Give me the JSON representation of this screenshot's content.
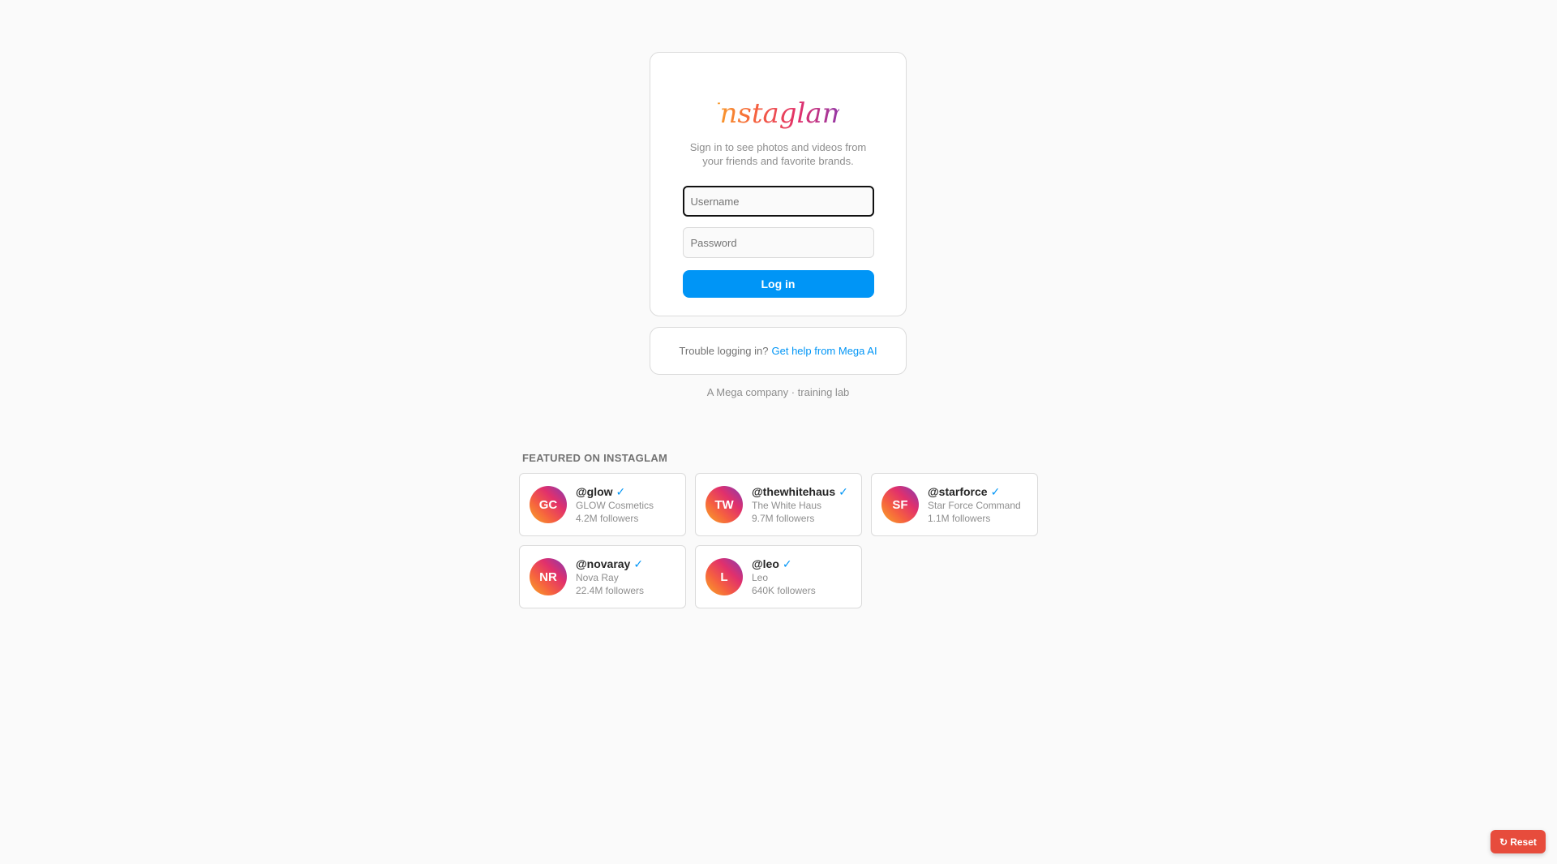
{
  "brand": {
    "logo_text": "Instaglam",
    "tagline": "Sign in to see photos and videos from your friends and favorite brands."
  },
  "login": {
    "username_placeholder": "Username",
    "password_placeholder": "Password",
    "login_label": "Log in"
  },
  "help": {
    "prompt": "Trouble logging in?",
    "link_label": "Get help from Mega AI"
  },
  "footer": {
    "company_line": "A Mega company · training lab"
  },
  "featured": {
    "heading": "FEATURED ON INSTAGLAM",
    "accounts": [
      {
        "initials": "GC",
        "handle": "@glow",
        "name": "GLOW Cosmetics",
        "followers": "4.2M followers"
      },
      {
        "initials": "TW",
        "handle": "@thewhitehaus",
        "name": "The White Haus",
        "followers": "9.7M followers"
      },
      {
        "initials": "SF",
        "handle": "@starforce",
        "name": "Star Force Command",
        "followers": "1.1M followers"
      },
      {
        "initials": "NR",
        "handle": "@novaray",
        "name": "Nova Ray",
        "followers": "22.4M followers"
      },
      {
        "initials": "L",
        "handle": "@leo",
        "name": "Leo",
        "followers": "640K followers"
      }
    ]
  },
  "reset": {
    "label": "Reset",
    "icon": "refresh-icon"
  },
  "colors": {
    "primary": "#0095f6",
    "reset": "#e74c3c",
    "gradient_start": "#f9a825",
    "gradient_end": "#833ab4"
  }
}
